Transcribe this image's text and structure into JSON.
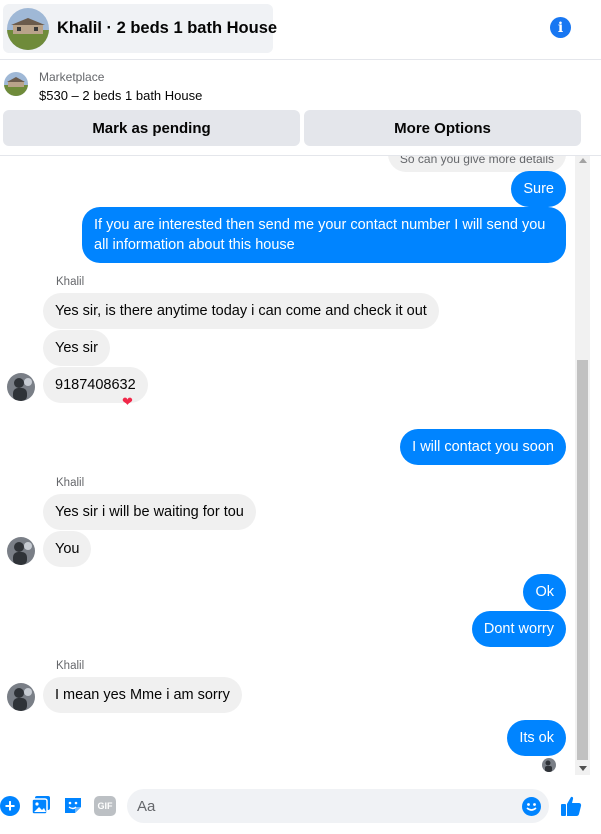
{
  "header": {
    "title": "Khalil · 2 beds 1 bath House",
    "info_icon": "info-icon",
    "info_glyph": "i"
  },
  "marketplace": {
    "label": "Marketplace",
    "listing": "$530 – 2 beds 1 bath House",
    "mark_pending_label": "Mark as pending",
    "more_options_label": "More Options"
  },
  "thread": {
    "partial_message": "So can you give more details",
    "sender_name": "Khalil",
    "messages": [
      {
        "from": "me",
        "text": "Sure"
      },
      {
        "from": "me",
        "text": "If you are interested then send me your contact number I will send you all information about this house"
      },
      {
        "from": "them",
        "text": "Yes sir, is there anytime today i can come and check it out"
      },
      {
        "from": "them",
        "text": "Yes sir"
      },
      {
        "from": "them",
        "text": "9187408632",
        "reaction": "❤"
      },
      {
        "from": "me",
        "text": "I will contact you soon"
      },
      {
        "from": "them",
        "text": "Yes sir i will be waiting for tou"
      },
      {
        "from": "them",
        "text": "You"
      },
      {
        "from": "me",
        "text": "Ok"
      },
      {
        "from": "me",
        "text": "Dont worry"
      },
      {
        "from": "them",
        "text": "I mean yes Mme i am sorry"
      },
      {
        "from": "me",
        "text": "Its ok"
      }
    ]
  },
  "composer": {
    "placeholder": "Aa",
    "gif_label": "GIF",
    "plus_glyph": "+",
    "icons": [
      "plus-icon",
      "image-icon",
      "sticker-icon",
      "gif-icon",
      "emoji-icon",
      "thumbs-up-icon"
    ]
  },
  "colors": {
    "accent": "#0084ff",
    "outgoing_bubble": "#0084ff",
    "incoming_bubble": "#f0f0f0",
    "reaction": "#f02849"
  }
}
